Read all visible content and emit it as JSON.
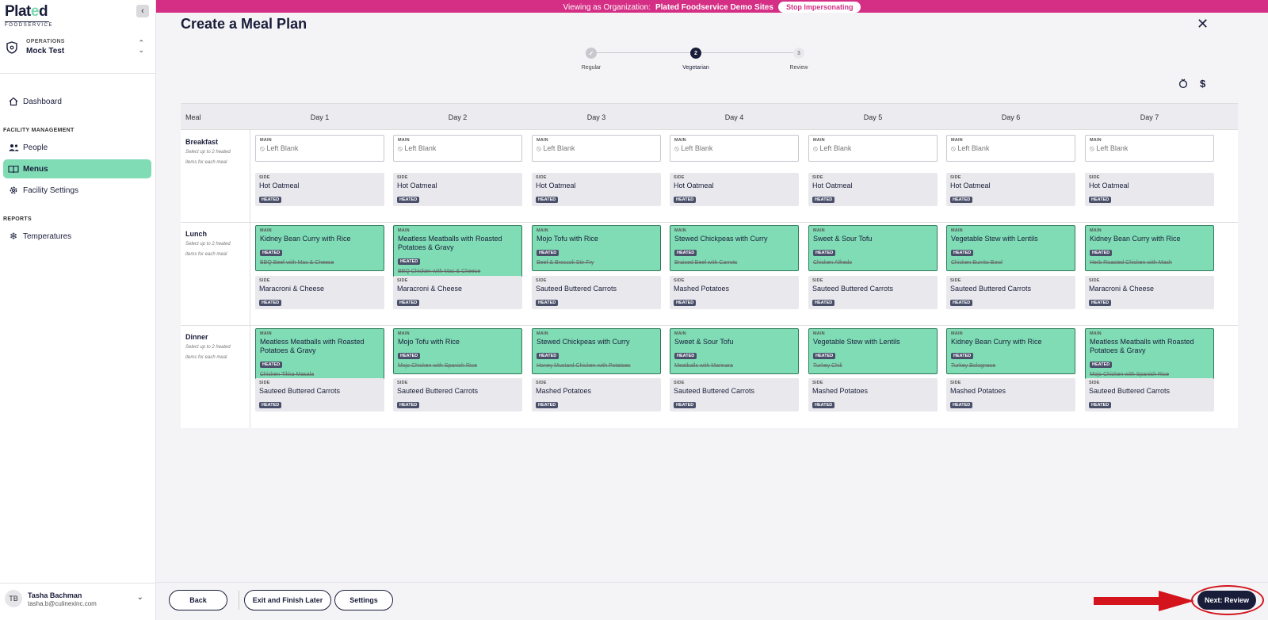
{
  "logo": {
    "main_a": "Plat",
    "main_o": "e",
    "main_b": "d",
    "sub": "FOODSERVICE"
  },
  "org": {
    "caption": "OPERATIONS",
    "name": "Mock Test"
  },
  "nav": {
    "dashboard": "Dashboard",
    "facility_section": "FACILITY MANAGEMENT",
    "people": "People",
    "menus": "Menus",
    "facility_settings": "Facility Settings",
    "reports_section": "REPORTS",
    "temperatures": "Temperatures"
  },
  "user": {
    "initials": "TB",
    "name": "Tasha Bachman",
    "email": "tasha.b@culinexinc.com"
  },
  "banner": {
    "prefix": "Viewing as Organization:",
    "org": "Plated Foodservice Demo Sites",
    "button": "Stop Impersonating"
  },
  "page": {
    "title": "Create a Meal Plan"
  },
  "stepper": {
    "steps": [
      {
        "num": "",
        "label": "Regular",
        "state": "done"
      },
      {
        "num": "2",
        "label": "Vegetarian",
        "state": "current"
      },
      {
        "num": "3",
        "label": "Review",
        "state": "todo"
      }
    ]
  },
  "grid": {
    "meal_header": "Meal",
    "days": [
      "Day 1",
      "Day 2",
      "Day 3",
      "Day 4",
      "Day 5",
      "Day 6",
      "Day 7"
    ],
    "hint": "Select up to 2 heated items for each meal",
    "main_cap": "MAIN",
    "side_cap": "SIDE",
    "heated": "HEATED",
    "blank": "Left Blank",
    "meals": [
      {
        "name": "Breakfast",
        "mains": [
          {
            "name": "",
            "blank": true
          },
          {
            "name": "",
            "blank": true
          },
          {
            "name": "",
            "blank": true
          },
          {
            "name": "",
            "blank": true
          },
          {
            "name": "",
            "blank": true
          },
          {
            "name": "",
            "blank": true
          },
          {
            "name": "",
            "blank": true
          }
        ],
        "sides": [
          "Hot Oatmeal",
          "Hot Oatmeal",
          "Hot Oatmeal",
          "Hot Oatmeal",
          "Hot Oatmeal",
          "Hot Oatmeal",
          "Hot Oatmeal"
        ]
      },
      {
        "name": "Lunch",
        "mains": [
          {
            "name": "Kidney Bean Curry with Rice",
            "replaced": "BBQ Beef with Mac & Cheese"
          },
          {
            "name": "Meatless Meatballs with Roasted Potatoes & Gravy",
            "replaced": "BBQ Chicken with Mac & Cheese"
          },
          {
            "name": "Mojo Tofu with Rice",
            "replaced": "Beef & Broccoli Stir Fry"
          },
          {
            "name": "Stewed Chickpeas with Curry",
            "replaced": "Braised Beef with Carrots"
          },
          {
            "name": "Sweet & Sour Tofu",
            "replaced": "Chicken Alfredo"
          },
          {
            "name": "Vegetable Stew with Lentils",
            "replaced": "Chicken Burrito Bowl"
          },
          {
            "name": "Kidney Bean Curry with Rice",
            "replaced": "Herb Roasted Chicken with Mash"
          }
        ],
        "sides": [
          "Maracroni & Cheese",
          "Maracroni & Cheese",
          "Sauteed Buttered Carrots",
          "Mashed Potatoes",
          "Sauteed Buttered Carrots",
          "Sauteed Buttered Carrots",
          "Maracroni & Cheese"
        ]
      },
      {
        "name": "Dinner",
        "mains": [
          {
            "name": "Meatless Meatballs with Roasted Potatoes & Gravy",
            "replaced": "Chicken Tikka Masala"
          },
          {
            "name": "Mojo Tofu with Rice",
            "replaced": "Mojo Chicken with Spanish Rice"
          },
          {
            "name": "Stewed Chickpeas with Curry",
            "replaced": "Honey Mustard Chicken with Potatoes"
          },
          {
            "name": "Sweet & Sour Tofu",
            "replaced": "Meatballs with Marinara"
          },
          {
            "name": "Vegetable Stew with Lentils",
            "replaced": "Turkey Chili"
          },
          {
            "name": "Kidney Bean Curry with Rice",
            "replaced": "Turkey Bolognese"
          },
          {
            "name": "Meatless Meatballs with Roasted Potatoes & Gravy",
            "replaced": "Mojo Chicken with Spanish Rice"
          }
        ],
        "sides": [
          "Sauteed Buttered Carrots",
          "Sauteed Buttered Carrots",
          "Mashed Potatoes",
          "Sauteed Buttered Carrots",
          "Mashed Potatoes",
          "Mashed Potatoes",
          "Sauteed Buttered Carrots"
        ]
      }
    ]
  },
  "footer": {
    "back": "Back",
    "exit": "Exit and Finish Later",
    "settings": "Settings",
    "next": "Next: Review"
  },
  "colors": {
    "accent_green": "#7fdcb5",
    "navy": "#1a1d3a",
    "banner_pink": "#d42e85",
    "annotation_red": "#d4141c"
  }
}
